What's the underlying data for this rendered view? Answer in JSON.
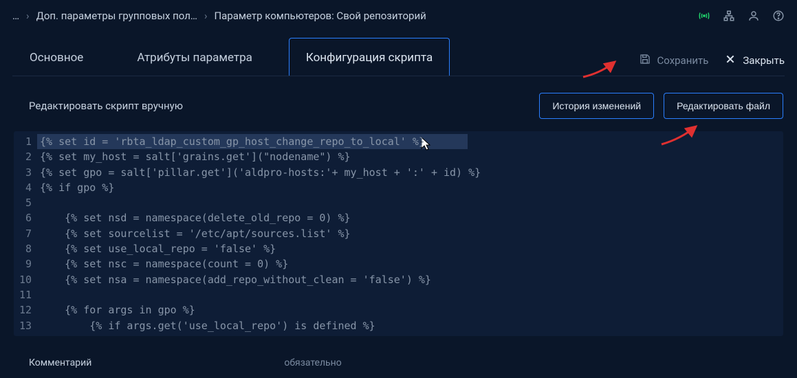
{
  "breadcrumb": {
    "ellipsis": "…",
    "item1": "Доп. параметры групповых пол…",
    "item2": "Параметр компьютеров: Свой репозиторий"
  },
  "tabs": {
    "t1": "Основное",
    "t2": "Атрибуты параметра",
    "t3": "Конфигурация скрипта"
  },
  "actions": {
    "save": "Сохранить",
    "close": "Закрыть"
  },
  "subheader": {
    "title": "Редактировать скрипт вручную",
    "history": "История изменений",
    "editfile": "Редактировать файл"
  },
  "code": {
    "lines": [
      "{% set id = 'rbta_ldap_custom_gp_host_change_repo_to_local' %}",
      "{% set my_host = salt['grains.get'](\"nodename\") %}",
      "{% set gpo = salt['pillar.get']('aldpro-hosts:'+ my_host + ':' + id) %}",
      "{% if gpo %}",
      "",
      "    {% set nsd = namespace(delete_old_repo = 0) %}",
      "    {% set sourcelist = '/etc/apt/sources.list' %}",
      "    {% set use_local_repo = 'false' %}",
      "    {% set nsc = namespace(count = 0) %}",
      "    {% set nsa = namespace(add_repo_without_clean = 'false') %}",
      "",
      "    {% for args in gpo %}",
      "        {% if args.get('use_local_repo') is defined %}"
    ],
    "highlight_line": 0,
    "highlight_width_ch": 62
  },
  "footer": {
    "label": "Комментарий",
    "required": "обязательно"
  }
}
